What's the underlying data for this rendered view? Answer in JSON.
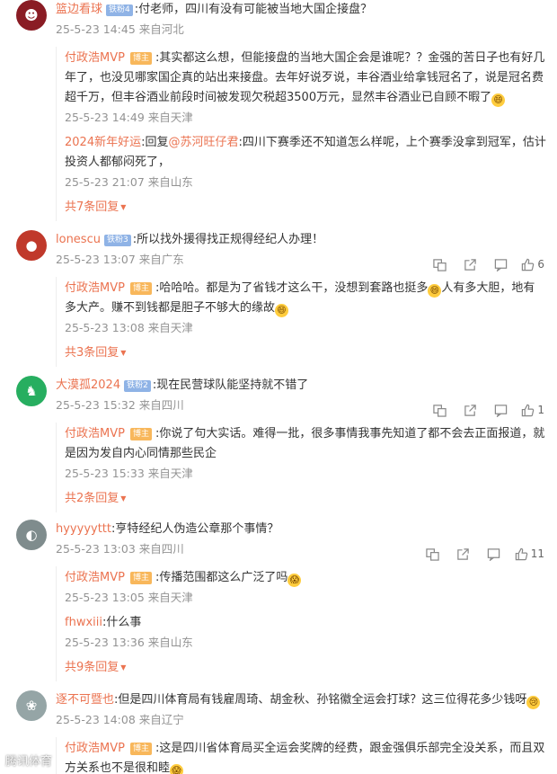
{
  "comments": [
    {
      "user": "篮边看球",
      "fan_badge": "铁粉4",
      "text": ":付老师，四川有没有可能被当地大国企接盘？",
      "date": "25-5-23 14:45",
      "location": "来自河北",
      "avatar_color": "#8a1c24",
      "replies": [
        {
          "user": "付政浩MVP",
          "badge": "博主",
          "text": ":其实都这么想，但能接盘的当地大国企会是谁呢？？金强的苦日子也有好几年了，也没见哪家国企真的站出来接盘。去年好说歹说，丰谷酒业给拿钱冠名了，说是冠名费超千万，但丰谷酒业前段时间被发现欠税超3500万元，显然丰谷酒业已自顾不暇了",
          "emoji": true,
          "date": "25-5-23 14:49",
          "location": "来自天津"
        },
        {
          "user": "2024新年好运",
          "prefix": ":回复",
          "mention": "@苏河旺仔君",
          "text": ":四川下赛季还不知道怎么样呢，上个赛季没拿到冠军，估计投资人都郁闷死了，",
          "date": "25-5-23 21:07",
          "location": "来自山东"
        }
      ],
      "more": "共7条回复"
    },
    {
      "user": "lonescu",
      "fan_badge": "铁粉3",
      "text": ":所以找外援得找正规得经纪人办理！",
      "date": "25-5-23 13:07",
      "location": "来自广东",
      "likes": "6",
      "avatar_color": "#c0392b",
      "replies": [
        {
          "user": "付政浩MVP",
          "badge": "博主",
          "text_a": ":哈哈哈。都是为了省钱才这么干，没想到套路也挺多",
          "text_b": "人有多大胆，地有多大产。赚不到钱都是胆子不够大的缘故",
          "date": "25-5-23 13:08",
          "location": "来自天津"
        }
      ],
      "more": "共3条回复"
    },
    {
      "user": "大漠孤2024",
      "fan_badge": "铁粉2",
      "text": ":现在民营球队能坚持就不错了",
      "date": "25-5-23 15:32",
      "location": "来自四川",
      "likes": "1",
      "avatar_color": "#27ae60",
      "replies": [
        {
          "user": "付政浩MVP",
          "badge": "博主",
          "text": ":你说了句大实话。难得一批，很多事情我事先知道了都不会去正面报道，就是因为发自内心同情那些民企",
          "date": "25-5-23 15:33",
          "location": "来自天津"
        }
      ],
      "more": "共2条回复"
    },
    {
      "user": "hyyyyyttt",
      "text": ":亨特经纪人伪造公章那个事情？",
      "date": "25-5-23 13:03",
      "location": "来自四川",
      "likes": "11",
      "avatar_color": "#7f8c8d",
      "replies": [
        {
          "user": "付政浩MVP",
          "badge": "博主",
          "text": ":传播范围都这么广泛了吗",
          "emoji": true,
          "date": "25-5-23 13:05",
          "location": "来自天津"
        },
        {
          "user": "fhwxiii",
          "text": ":什么事",
          "date": "25-5-23 13:36",
          "location": "来自山东"
        }
      ],
      "more": "共9条回复"
    },
    {
      "user": "逐不可暨也",
      "text": ":但是四川体育局有钱雇周琦、胡金秋、孙铭徽全运会打球？这三位得花多少钱呀",
      "emoji": true,
      "date": "25-5-23 14:08",
      "location": "来自辽宁",
      "avatar_color": "#95a5a6",
      "replies": [
        {
          "user": "付政浩MVP",
          "badge": "博主",
          "text": ":这是四川省体育局买全运会奖牌的经费，跟金强俱乐部完全没关系，而且双方关系也不是很和睦",
          "emoji": true
        }
      ]
    }
  ],
  "watermark": "腾讯体育",
  "colors": {
    "name": "#eb7350",
    "meta": "#939393",
    "bozhu": "#f8b75b",
    "fan": "#8fb3e6"
  },
  "icons": [
    "translate-icon",
    "share-icon",
    "comment-icon",
    "like-icon"
  ]
}
